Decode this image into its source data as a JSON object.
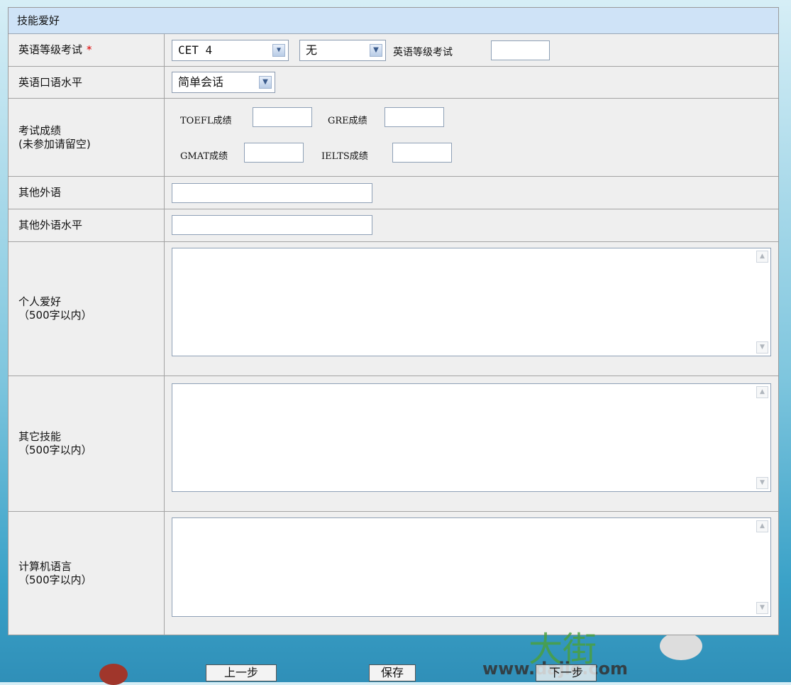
{
  "section_title": "技能爱好",
  "rows": {
    "english_exam": {
      "label": "英语等级考试",
      "required_mark": "*",
      "level_select": "CET 4",
      "score_select": "无",
      "score_label": "英语等级考试"
    },
    "spoken": {
      "label": "英语口语水平",
      "select": "简单会话"
    },
    "scores": {
      "label_line1": "考试成绩",
      "label_line2": "(未参加请留空)",
      "toefl": "TOEFL成绩",
      "gre": "GRE成绩",
      "gmat": "GMAT成绩",
      "ielts": "IELTS成绩"
    },
    "other_language": {
      "label": "其他外语"
    },
    "other_language_level": {
      "label": "其他外语水平"
    },
    "hobbies": {
      "label": "个人爱好",
      "limit": "（500字以内）"
    },
    "skills": {
      "label": "其它技能",
      "limit": "（500字以内）"
    },
    "computer": {
      "label": "计算机语言",
      "limit": "（500字以内）"
    }
  },
  "buttons": {
    "prev": "上一步",
    "save": "保存",
    "next": "下一步"
  },
  "watermark": {
    "brand": "大街",
    "url": "www.dajie.com"
  },
  "icons": {
    "dropdown": "chevron-down-icon",
    "scroll_up": "scroll-up-icon",
    "scroll_down": "scroll-down-icon"
  }
}
